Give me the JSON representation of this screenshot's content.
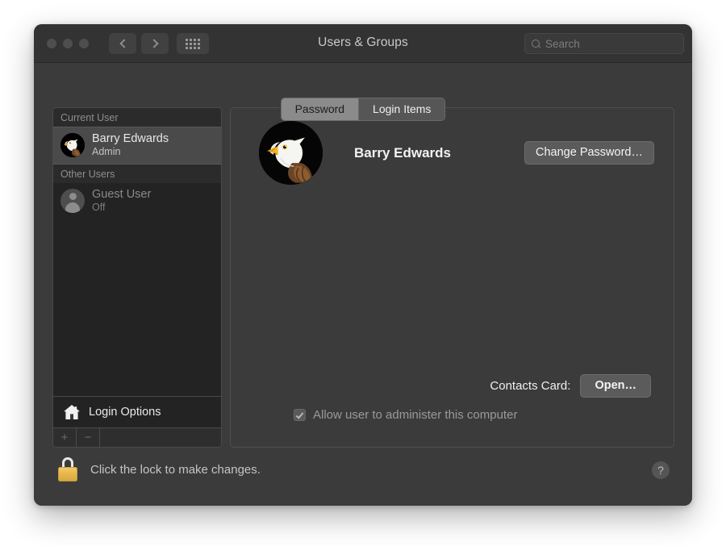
{
  "window": {
    "title": "Users & Groups",
    "traffic_lights": [
      "close",
      "minimize",
      "zoom"
    ],
    "nav": {
      "back": "‹",
      "forward": "›",
      "show_all": "show-all-grid"
    },
    "search": {
      "placeholder": "Search",
      "value": ""
    }
  },
  "sidebar": {
    "groups": [
      {
        "header": "Current User",
        "users": [
          {
            "name": "Barry Edwards",
            "role": "Admin",
            "avatar": "eagle-photo",
            "selected": true,
            "dim": false
          }
        ]
      },
      {
        "header": "Other Users",
        "users": [
          {
            "name": "Guest User",
            "role": "Off",
            "avatar": "person-silhouette",
            "selected": false,
            "dim": true
          }
        ]
      }
    ],
    "login_options": {
      "label": "Login Options",
      "icon": "house-icon"
    },
    "add_remove": {
      "add": "+",
      "remove": "−"
    }
  },
  "tabs": [
    {
      "label": "Password",
      "active": true
    },
    {
      "label": "Login Items",
      "active": false
    }
  ],
  "panel": {
    "profile": {
      "name": "Barry Edwards",
      "avatar": "eagle-photo"
    },
    "change_password_label": "Change Password…",
    "contacts": {
      "label": "Contacts Card:",
      "button": "Open…"
    },
    "admin_checkbox": {
      "label": "Allow user to administer this computer",
      "checked": true,
      "disabled": true
    }
  },
  "footer": {
    "lock_text": "Click the lock to make changes.",
    "lock_state": "locked",
    "help_label": "?"
  },
  "colors": {
    "window_bg": "#3b3b3b",
    "titlebar_bg": "#333333",
    "sidebar_bg": "#232323",
    "selected_row": "#4a4a4a",
    "tab_active_bg": "#8b8b8b",
    "tab_inactive_bg": "#565656",
    "button_bg": "#5b5b5b",
    "lock_gold": "#e8b94f",
    "desktop_bg": "#ffffff"
  }
}
